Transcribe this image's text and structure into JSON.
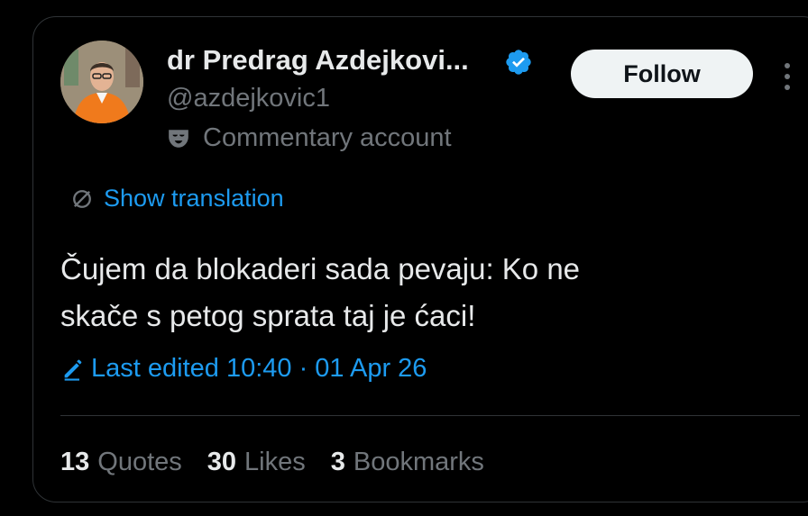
{
  "author": {
    "display_name": "dr Predrag Azdejkovi...",
    "handle": "@azdejkovic1",
    "account_label": "Commentary account",
    "verified": true
  },
  "actions": {
    "follow_label": "Follow"
  },
  "translation": {
    "label": "Show translation"
  },
  "tweet": {
    "text": "Čujem da blokaderi sada pevaju: Ko ne\nskače s petog sprata taj je ćaci!",
    "edited_label": "Last edited 10:40 · 01 Apr 26"
  },
  "stats": {
    "quotes_count": "13",
    "quotes_label": "Quotes",
    "likes_count": "30",
    "likes_label": "Likes",
    "bookmarks_count": "3",
    "bookmarks_label": "Bookmarks"
  },
  "colors": {
    "background": "#000000",
    "text_primary": "#e7e9ea",
    "text_secondary": "#71767b",
    "accent": "#1d9bf0",
    "follow_bg": "#eff3f4",
    "border": "#2f3336"
  }
}
